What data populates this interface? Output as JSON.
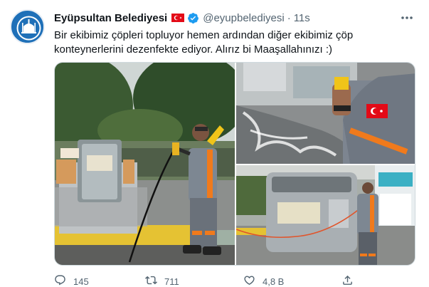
{
  "tweet": {
    "display_name": "Eyüpsultan Belediyesi",
    "handle": "@eyupbelediyesi",
    "separator": "·",
    "time": "11s",
    "text": "Bir ekibimiz çöpleri topluyor hemen ardından diğer ekibimiz çöp konteynerlerini dezenfekte ediyor. Alırız bi Maaşallahınızı :)",
    "more_icon": "more-dots-icon",
    "verified_icon": "verified-badge-icon",
    "flag_icon": "turkey-flag-icon"
  },
  "actions": {
    "reply_count": "145",
    "retweet_count": "711",
    "like_count": "4,8 B"
  },
  "colors": {
    "text": "#0f1419",
    "secondary": "#536471",
    "verified": "#1d9bf0",
    "flag": "#e30a17",
    "vest_orange": "#f07a1c"
  }
}
